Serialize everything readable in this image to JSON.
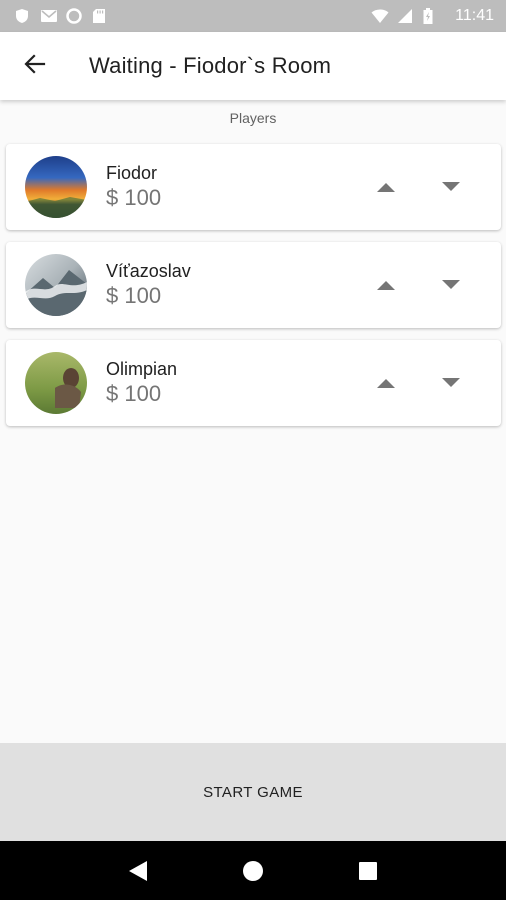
{
  "status_bar": {
    "time": "11:41",
    "left_icons": [
      "shield-icon",
      "mail-icon",
      "circle-icon",
      "sd-card-icon"
    ],
    "right_icons": [
      "wifi-icon",
      "signal-icon",
      "battery-icon"
    ]
  },
  "app_bar": {
    "back_icon": "arrow-back-icon",
    "title": "Waiting - Fiodor`s Room"
  },
  "section_label": "Players",
  "players": [
    {
      "name": "Fiodor",
      "money": "$ 100",
      "avatar": "sunset-landscape"
    },
    {
      "name": "Víťazoslav",
      "money": "$ 100",
      "avatar": "misty-mountain"
    },
    {
      "name": "Olimpian",
      "money": "$ 100",
      "avatar": "grass-scene"
    }
  ],
  "start_button": {
    "label": "START GAME"
  },
  "nav_bar": {
    "icons": [
      "back-triangle-icon",
      "home-circle-icon",
      "recents-square-icon"
    ]
  },
  "colors": {
    "status_bar": "#bdbdbd",
    "background": "#fafafa",
    "start_bar": "#e0e0e0",
    "money_text": "#757575",
    "arrow": "#757575"
  }
}
